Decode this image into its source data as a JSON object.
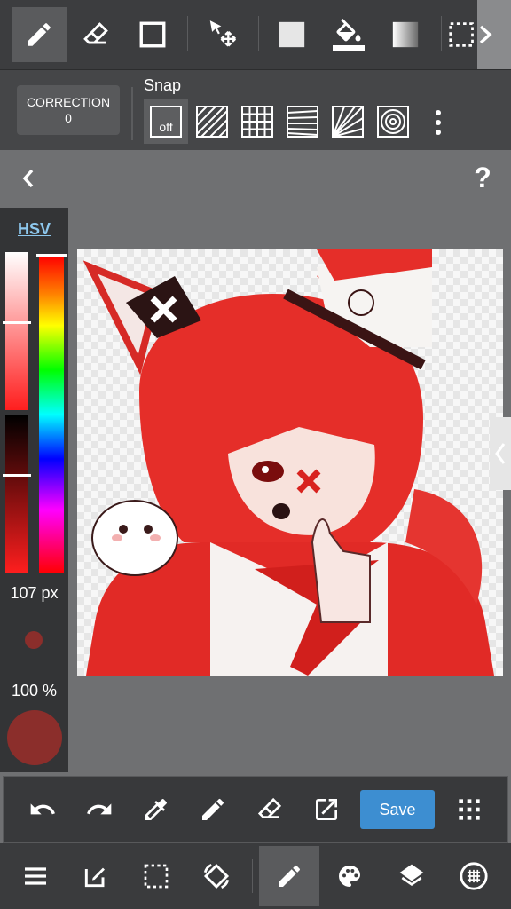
{
  "top_toolbar": {
    "tools": [
      {
        "name": "pen-tool",
        "icon": "pencil-icon",
        "active": true
      },
      {
        "name": "eraser-tool",
        "icon": "eraser-icon"
      },
      {
        "name": "rectangle-tool",
        "icon": "square-outline-icon"
      },
      {
        "name": "move-tool",
        "icon": "move-arrow-icon"
      },
      {
        "name": "fill-color-tool",
        "icon": "filled-square-icon"
      },
      {
        "name": "bucket-tool",
        "icon": "paint-bucket-icon"
      },
      {
        "name": "gradient-tool",
        "icon": "gradient-icon"
      },
      {
        "name": "select-tool",
        "icon": "dashed-selection-icon"
      }
    ]
  },
  "correction": {
    "label": "CORRECTION",
    "value": "0"
  },
  "snap": {
    "label": "Snap",
    "off_label": "off",
    "options": [
      "parallel-snap-icon",
      "grid-snap-icon",
      "perspective-snap-icon",
      "radial-snap-icon",
      "circle-snap-icon"
    ]
  },
  "nav": {
    "back_icon": "chevron-left-icon",
    "help_label": "?"
  },
  "color_panel": {
    "mode_label": "HSV",
    "brush_size": "107 px",
    "opacity": "100 %",
    "current_color": "#8b2e2b",
    "colors": {
      "accent": "#ff2a2a",
      "tab": "#8ec8ee"
    }
  },
  "action_bar": {
    "buttons": [
      "undo-icon",
      "redo-icon",
      "eyedropper-icon",
      "pencil-icon",
      "eraser-icon",
      "export-icon"
    ],
    "save_label": "Save",
    "grid_icon": "dots-grid-icon"
  },
  "bottom_bar": {
    "buttons": [
      "menu-icon",
      "edit-icon",
      "selection-icon",
      "transform-icon",
      "brush-icon",
      "palette-icon",
      "layers-icon",
      "material-icon"
    ],
    "active": "brush-icon"
  }
}
